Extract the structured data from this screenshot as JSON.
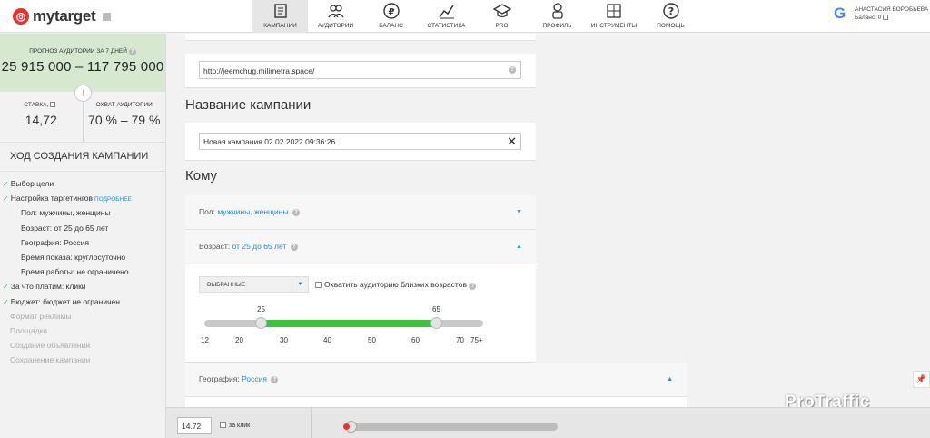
{
  "brand": {
    "name": "mytarget"
  },
  "nav": [
    {
      "label": "Кампании",
      "icon": "campaigns-icon",
      "active": true
    },
    {
      "label": "Аудитории",
      "icon": "audiences-icon"
    },
    {
      "label": "Баланс",
      "icon": "ruble-icon"
    },
    {
      "label": "Статистика",
      "icon": "statistics-icon"
    },
    {
      "label": "PRO",
      "icon": "graduation-cap-icon"
    },
    {
      "label": "Профиль",
      "icon": "profile-icon"
    },
    {
      "label": "Инструменты",
      "icon": "tools-icon"
    },
    {
      "label": "Помощь",
      "icon": "help-icon"
    }
  ],
  "user": {
    "name": "АНАСТАСИЯ ВОРОБЬЕВА",
    "balance": "Баланс: 0"
  },
  "sidebar": {
    "forecast_label": "ПРОГНОЗ АУДИТОРИИ ЗА 7 ДНЕЙ",
    "forecast_value": "25 915 000 – 117 795 000",
    "bid_label": "СТАВКА,",
    "bid_value": "14,72",
    "reach_label": "ОХВАТ АУДИТОРИИ",
    "reach_value": "70 % – 79 %",
    "progress_title": "ХОД СОЗДАНИЯ КАМПАНИИ",
    "steps": [
      {
        "label": "Выбор цели"
      },
      {
        "label": "Настройка таргетингов",
        "extra": "ПОДРОБНЕЕ"
      },
      {
        "label": "Пол: мужчины, женщины"
      },
      {
        "label": "Возраст: от 25 до 65 лет"
      },
      {
        "label": "География: Россия"
      },
      {
        "label": "Время показа: круглосуточно"
      },
      {
        "label": "Время работы: не ограничено"
      },
      {
        "label": "За что платим: клики"
      },
      {
        "label": "Бюджет: бюджет не ограничен"
      },
      {
        "label": "Формат рекламы"
      },
      {
        "label": "Площадки"
      },
      {
        "label": "Создание объявлений"
      },
      {
        "label": "Сохранение кампании"
      }
    ]
  },
  "main": {
    "url": "http://jeemchug.milimetra.space/",
    "name_title": "Название кампании",
    "name_value": "Новая кампания 02.02.2022 09:36:26",
    "whom_title": "Кому",
    "gender_label": "Пол:",
    "gender_value": "мужчины, женщины",
    "age_label": "Возраст:",
    "age_value": "от 25 до 65 лет",
    "age_select": "ВЫБРАННЫЕ",
    "age_checkbox": "Охватить аудиторию близких возрастов",
    "age_from": "25",
    "age_to": "65",
    "age_ticks": [
      "12",
      "20",
      "30",
      "40",
      "50",
      "60",
      "70",
      "75+"
    ],
    "geo_label": "География:",
    "geo_value": "Россия"
  },
  "bottom": {
    "bid": "14.72",
    "per_click": "за клик",
    "budget_level": 0
  },
  "watermark": "ProTraffic"
}
